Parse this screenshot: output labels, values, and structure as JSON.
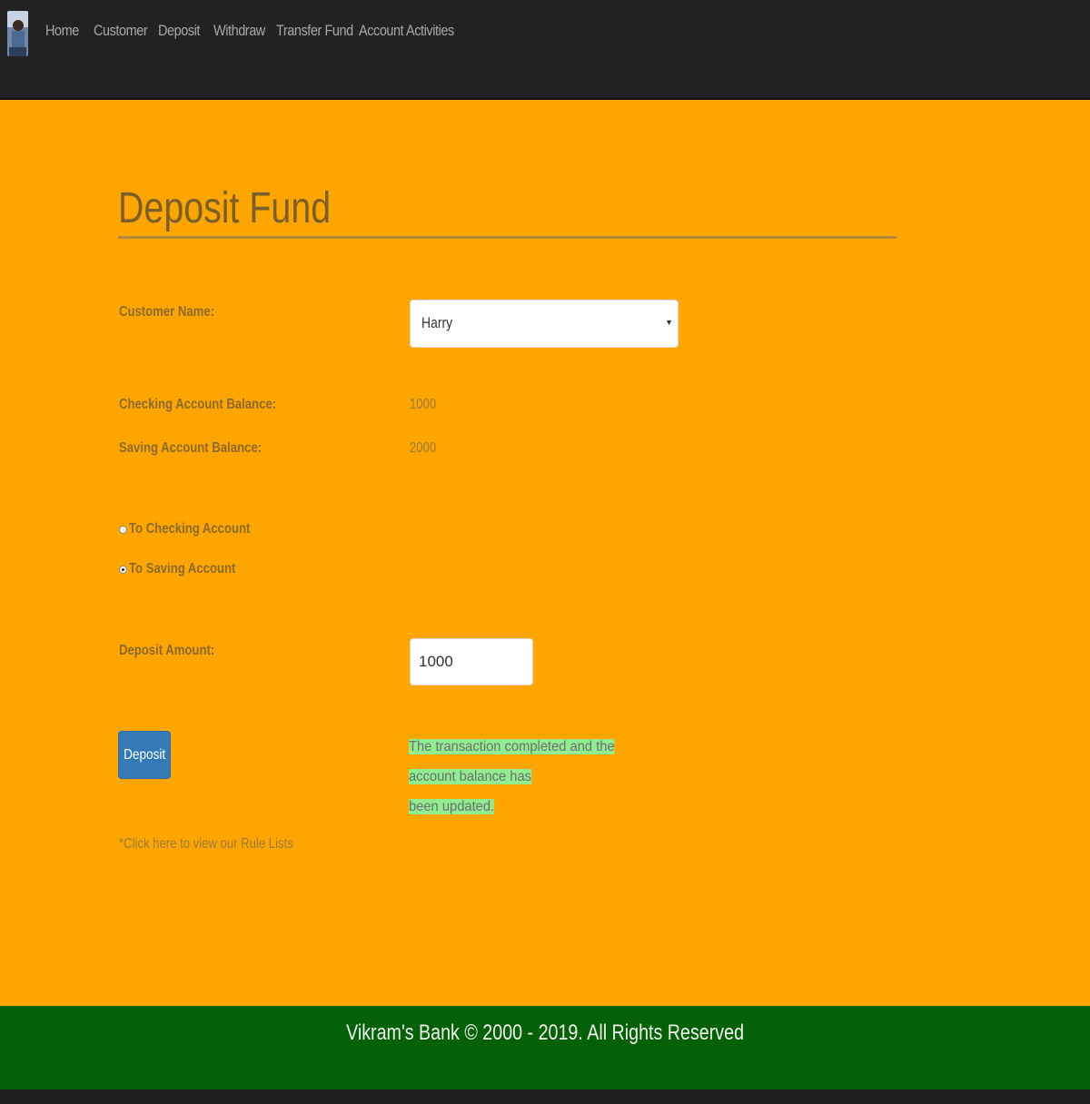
{
  "nav": {
    "items": [
      "Home",
      "Customer",
      "Deposit",
      "Withdraw",
      "Transfer Fund",
      "Account Activities"
    ]
  },
  "page": {
    "title": "Deposit Fund"
  },
  "form": {
    "customer_label": "Customer Name:",
    "customer_selected": "Harry",
    "checking_label": "Checking Account Balance:",
    "checking_value": "1000",
    "saving_label": "Saving Account Balance:",
    "saving_value": "2000",
    "radio_checking_label": "To Checking Account",
    "radio_saving_label": "To Saving Account",
    "radio_selected": "saving",
    "amount_label": "Deposit Amount:",
    "amount_value": "1000",
    "deposit_button": "Deposit",
    "success_line1": "The transaction completed and the account balance has",
    "success_line2": "been updated.",
    "rule_link": "*Click here to view our Rule Lists"
  },
  "footer": {
    "text": "Vikram's Bank © 2000 - 2019. All Rights Reserved"
  },
  "colors": {
    "navbar": "#222222",
    "main_bg": "#ffa500",
    "footer_bg": "#056105",
    "button": "#337ab7",
    "success_highlight": "#90ee90"
  }
}
